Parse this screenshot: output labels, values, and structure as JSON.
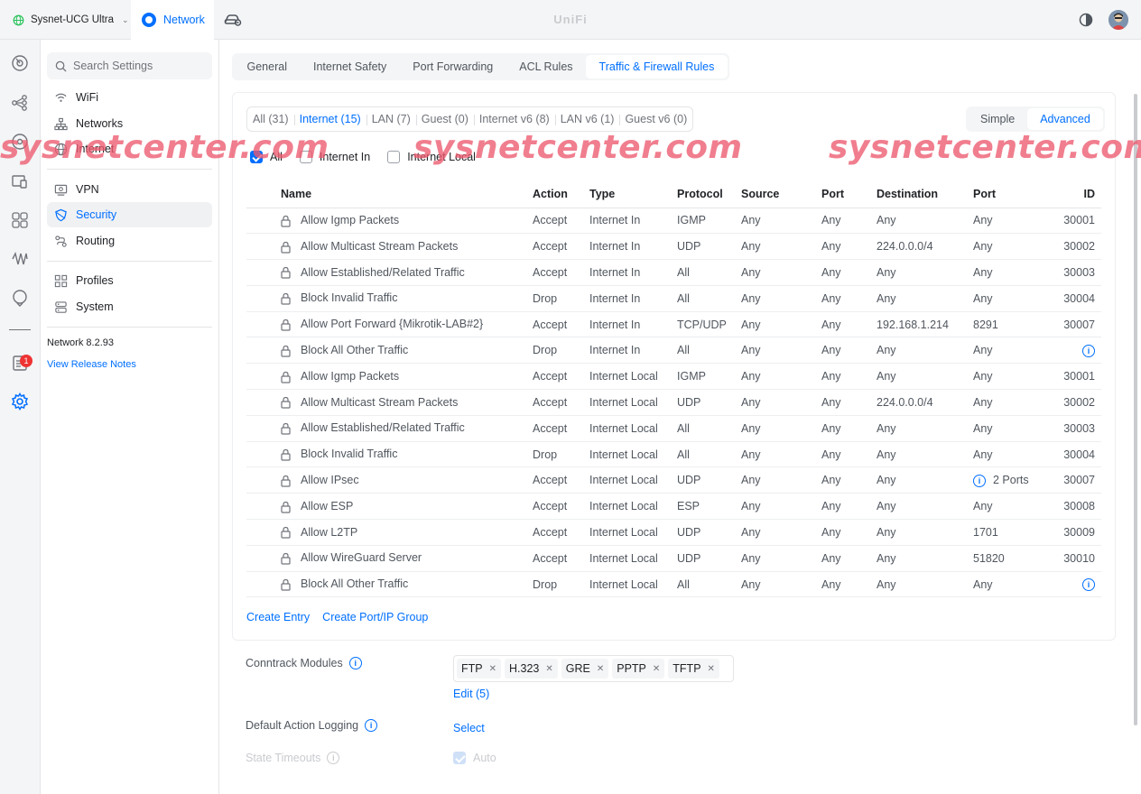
{
  "topbar": {
    "site_name": "Sysnet-UCG Ultra",
    "app_label": "Network",
    "brand": "UniFi"
  },
  "rail_icons": [
    "dashboard-icon",
    "topology-icon",
    "devices-icon",
    "client-devices-icon",
    "ports-icon",
    "insights-icon",
    "radio-icon",
    "alarm-icon",
    "notes-icon",
    "settings-icon"
  ],
  "rail_badge": "1",
  "sidebar": {
    "search_placeholder": "Search Settings",
    "groups": [
      [
        {
          "label": "WiFi",
          "icon": "wifi-icon"
        },
        {
          "label": "Networks",
          "icon": "network-tree-icon"
        },
        {
          "label": "Internet",
          "icon": "globe-icon"
        }
      ],
      [
        {
          "label": "VPN",
          "icon": "vpn-icon"
        },
        {
          "label": "Security",
          "icon": "shield-icon",
          "active": true
        },
        {
          "label": "Routing",
          "icon": "routing-icon"
        }
      ],
      [
        {
          "label": "Profiles",
          "icon": "profiles-icon"
        },
        {
          "label": "System",
          "icon": "system-icon"
        }
      ]
    ],
    "version": "Network 8.2.93",
    "release_notes": "View Release Notes"
  },
  "tabs": [
    {
      "label": "General"
    },
    {
      "label": "Internet Safety"
    },
    {
      "label": "Port Forwarding"
    },
    {
      "label": "ACL Rules"
    },
    {
      "label": "Traffic & Firewall Rules",
      "active": true
    }
  ],
  "filters": [
    {
      "label": "All (31)"
    },
    {
      "label": "Internet (15)",
      "active": true
    },
    {
      "label": "LAN (7)"
    },
    {
      "label": "Guest (0)"
    },
    {
      "label": "Internet v6 (8)"
    },
    {
      "label": "LAN v6 (1)"
    },
    {
      "label": "Guest v6 (0)"
    }
  ],
  "mode": {
    "simple": "Simple",
    "advanced": "Advanced"
  },
  "checkboxes": [
    {
      "label": "All",
      "checked": true
    },
    {
      "label": "Internet In",
      "checked": false
    },
    {
      "label": "Internet Local",
      "checked": false
    }
  ],
  "table": {
    "headers": [
      "Name",
      "Action",
      "Type",
      "Protocol",
      "Source",
      "Port",
      "Destination",
      "Port",
      "ID"
    ],
    "rows": [
      {
        "name": "Allow Igmp Packets",
        "action": "Accept",
        "type": "Internet In",
        "protocol": "IGMP",
        "source": "Any",
        "src_port": "Any",
        "destination": "Any",
        "dst_port": "Any",
        "id": "30001"
      },
      {
        "name": "Allow Multicast Stream Packets",
        "action": "Accept",
        "type": "Internet In",
        "protocol": "UDP",
        "source": "Any",
        "src_port": "Any",
        "destination": "224.0.0.0/4",
        "dst_port": "Any",
        "id": "30002"
      },
      {
        "name": "Allow Established/Related Traffic",
        "action": "Accept",
        "type": "Internet In",
        "protocol": "All",
        "source": "Any",
        "src_port": "Any",
        "destination": "Any",
        "dst_port": "Any",
        "id": "30003"
      },
      {
        "name": "Block Invalid Traffic",
        "action": "Drop",
        "type": "Internet In",
        "protocol": "All",
        "source": "Any",
        "src_port": "Any",
        "destination": "Any",
        "dst_port": "Any",
        "id": "30004"
      },
      {
        "name": "Allow Port Forward {Mikrotik-LAB#2}",
        "action": "Accept",
        "type": "Internet In",
        "protocol": "TCP/UDP",
        "source": "Any",
        "src_port": "Any",
        "destination": "192.168.1.214",
        "dst_port": "8291",
        "id": "30007"
      },
      {
        "name": "Block All Other Traffic",
        "action": "Drop",
        "type": "Internet In",
        "protocol": "All",
        "source": "Any",
        "src_port": "Any",
        "destination": "Any",
        "dst_port": "Any",
        "id": "",
        "id_info": true
      },
      {
        "name": "Allow Igmp Packets",
        "action": "Accept",
        "type": "Internet Local",
        "protocol": "IGMP",
        "source": "Any",
        "src_port": "Any",
        "destination": "Any",
        "dst_port": "Any",
        "id": "30001"
      },
      {
        "name": "Allow Multicast Stream Packets",
        "action": "Accept",
        "type": "Internet Local",
        "protocol": "UDP",
        "source": "Any",
        "src_port": "Any",
        "destination": "224.0.0.0/4",
        "dst_port": "Any",
        "id": "30002"
      },
      {
        "name": "Allow Established/Related Traffic",
        "action": "Accept",
        "type": "Internet Local",
        "protocol": "All",
        "source": "Any",
        "src_port": "Any",
        "destination": "Any",
        "dst_port": "Any",
        "id": "30003"
      },
      {
        "name": "Block Invalid Traffic",
        "action": "Drop",
        "type": "Internet Local",
        "protocol": "All",
        "source": "Any",
        "src_port": "Any",
        "destination": "Any",
        "dst_port": "Any",
        "id": "30004"
      },
      {
        "name": "Allow IPsec",
        "action": "Accept",
        "type": "Internet Local",
        "protocol": "UDP",
        "source": "Any",
        "src_port": "Any",
        "destination": "Any",
        "dst_port": "2 Ports",
        "dst_port_info": true,
        "id": "30007"
      },
      {
        "name": "Allow ESP",
        "action": "Accept",
        "type": "Internet Local",
        "protocol": "ESP",
        "source": "Any",
        "src_port": "Any",
        "destination": "Any",
        "dst_port": "Any",
        "id": "30008"
      },
      {
        "name": "Allow L2TP",
        "action": "Accept",
        "type": "Internet Local",
        "protocol": "UDP",
        "source": "Any",
        "src_port": "Any",
        "destination": "Any",
        "dst_port": "1701",
        "id": "30009"
      },
      {
        "name": "Allow WireGuard Server",
        "action": "Accept",
        "type": "Internet Local",
        "protocol": "UDP",
        "source": "Any",
        "src_port": "Any",
        "destination": "Any",
        "dst_port": "51820",
        "id": "30010"
      },
      {
        "name": "Block All Other Traffic",
        "action": "Drop",
        "type": "Internet Local",
        "protocol": "All",
        "source": "Any",
        "src_port": "Any",
        "destination": "Any",
        "dst_port": "Any",
        "id": "",
        "id_info": true
      }
    ]
  },
  "actions": {
    "create_entry": "Create Entry",
    "create_group": "Create Port/IP Group"
  },
  "conntrack": {
    "label": "Conntrack Modules",
    "modules": [
      "FTP",
      "H.323",
      "GRE",
      "PPTP",
      "TFTP"
    ],
    "edit": "Edit (5)"
  },
  "logging": {
    "label": "Default Action Logging",
    "value": "Select"
  },
  "timeouts": {
    "label": "State Timeouts",
    "auto": "Auto"
  },
  "watermark": "sysnetcenter.com",
  "colors": {
    "accent": "#006fff",
    "watermark": "#ec5a6e"
  }
}
